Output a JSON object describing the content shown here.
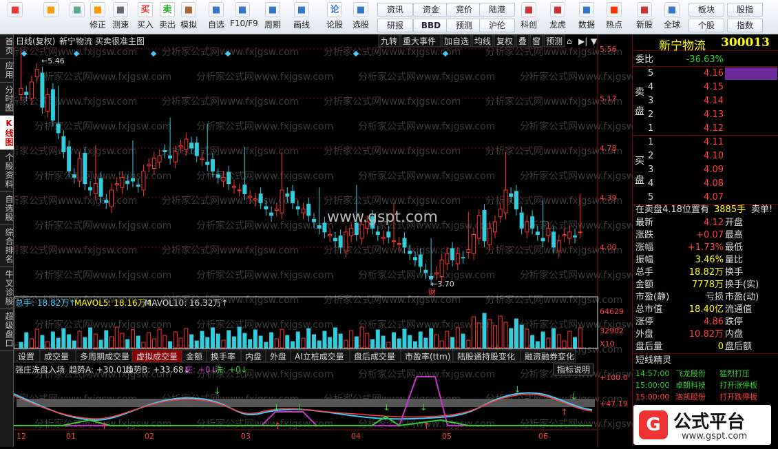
{
  "toolbar": {
    "buttons": [
      {
        "label": "",
        "icon": "grid-icon"
      },
      {
        "label": "",
        "icon": "back-arrow-icon"
      },
      {
        "label": "",
        "icon": "up-down-icon"
      },
      {
        "label": "修正",
        "icon": "fix-icon"
      },
      {
        "label": "测速",
        "icon": "clock-icon"
      },
      {
        "label": "买入",
        "icon": "buy-icon",
        "glyph": "买"
      },
      {
        "label": "卖出",
        "icon": "sell-icon",
        "glyph": "卖"
      },
      {
        "label": "模拟",
        "icon": "hammer-icon"
      },
      {
        "label": "自选",
        "icon": "star-icon"
      },
      {
        "label": "F10/F9",
        "icon": "f10-icon"
      },
      {
        "label": "周期",
        "icon": "cycle-icon"
      },
      {
        "label": "画线",
        "icon": "pen-icon"
      },
      {
        "label": "论股",
        "icon": "discuss-icon",
        "glyph": "论"
      },
      {
        "label": "选股",
        "icon": "select-icon"
      },
      {
        "label": "科创",
        "icon": "kechuang-icon"
      },
      {
        "label": "龙虎",
        "icon": "dragon-icon"
      },
      {
        "label": "数据",
        "icon": "pe-icon"
      },
      {
        "label": "热点",
        "icon": "fire-icon"
      },
      {
        "label": "新股",
        "icon": "newstock-icon"
      },
      {
        "label": "全球",
        "icon": "globe-icon"
      }
    ],
    "small_buttons": [
      "资讯",
      "资金",
      "竞价",
      "陆港",
      "研报",
      "BBD",
      "预测",
      "沪伦",
      "板块",
      "股指",
      "个股",
      "指数"
    ]
  },
  "left_tabs": [
    "首页",
    "应用",
    "分时图",
    "K线图",
    "个股资料",
    "自选股",
    "综合排名",
    "牛叉诊股",
    "超级盘口"
  ],
  "chart": {
    "title": "日线(复权)",
    "stock_name": "新宁物流",
    "indicator_name": "买卖很准主图",
    "top_buttons": [
      "九转",
      "重大事件",
      "加自选",
      "均线",
      "复权",
      "叠",
      "窗",
      "预测"
    ],
    "price_labels": [
      "5.56",
      "5.17",
      "4.78",
      "4.39",
      "4.00"
    ],
    "high_mark": "5.46",
    "low_mark": "3.70",
    "low_tag": "财",
    "watermark": "www.gspt.com",
    "watermark_bg": "分析家公式网www.fxjgsw.com",
    "volume_title": "总手: 18.82万↑",
    "mavol5": "MAVOL5: 18.16万↑",
    "mavol10": "MAVOL10: 16.32万↑",
    "volume_labels": [
      "64629",
      "32902",
      "X10"
    ],
    "indicator_tabs": [
      "设置",
      "成交量",
      "多周期成交量",
      "虚拟成交量",
      "金额",
      "换手率",
      "内盘",
      "外盘",
      "AI立桩成交量",
      "盘后成交量",
      "市盈率(ttm)",
      "陆股通持股变化",
      "融资融券变化"
    ],
    "sub_title": "强庄洗盘入场",
    "sub_values": [
      "趋势A: +30.01↓",
      "趋势B: +33.68↓",
      "庄: +0↓",
      "洗: +0↓"
    ],
    "sub_button": "指标说明",
    "sub_labels": [
      "+100.0",
      "+47.19"
    ],
    "months": [
      "12",
      "01",
      "02",
      "03",
      "04",
      "05",
      "06"
    ],
    "brand_text": "公式平台",
    "brand_url": "www.gspt.com"
  },
  "quote": {
    "name": "新宁物流",
    "code": "300013",
    "weibi_label": "委比",
    "weibi": "-36.63%",
    "sell_label": "卖盘",
    "buy_label": "买盘",
    "sells": [
      {
        "lvl": "5",
        "price": "4.16"
      },
      {
        "lvl": "4",
        "price": "4.15"
      },
      {
        "lvl": "3",
        "price": "4.14"
      },
      {
        "lvl": "2",
        "price": "4.13"
      },
      {
        "lvl": "1",
        "price": "4.12"
      }
    ],
    "buys": [
      {
        "lvl": "1",
        "price": "4.11"
      },
      {
        "lvl": "2",
        "price": "4.10"
      },
      {
        "lvl": "3",
        "price": "4.09"
      },
      {
        "lvl": "4",
        "price": "4.08"
      },
      {
        "lvl": "5",
        "price": "4.07"
      }
    ],
    "notice": "在卖盘4.18位置有",
    "notice_vol": "3885手",
    "notice_tag": "卖单!",
    "stats": [
      {
        "l": "最新",
        "v": "4.12",
        "r": "开盘",
        "c": "red"
      },
      {
        "l": "涨跌",
        "v": "+0.07",
        "r": "最高",
        "c": "red"
      },
      {
        "l": "涨幅",
        "v": "+1.73%",
        "r": "最低",
        "c": "red"
      },
      {
        "l": "振幅",
        "v": "3.46%",
        "r": "量比",
        "c": "yellow"
      },
      {
        "l": "总手",
        "v": "18.82万",
        "r": "换手",
        "c": "yellow"
      },
      {
        "l": "金额",
        "v": "7778万",
        "r": "换手(实)",
        "c": "yellow"
      },
      {
        "l": "市盈(静)",
        "v": "亏损",
        "r": "市盈(动)",
        "c": "white"
      },
      {
        "l": "总市值",
        "v": "18.40亿",
        "r": "流通值",
        "c": "yellow"
      },
      {
        "l": "涨停",
        "v": "4.86",
        "r": "跌停",
        "c": "red"
      },
      {
        "l": "外盘",
        "v": "10.82万",
        "r": "内盘",
        "c": "red"
      },
      {
        "l": "盘后量",
        "v": "0",
        "r": "盘后额",
        "c": "yellow"
      }
    ],
    "elves_title": "短线精灵",
    "elves": [
      {
        "t": "14:57:00",
        "n": "飞龙股份",
        "e": "猛烈打压",
        "c": "green"
      },
      {
        "t": "15:00:00",
        "n": "卓朗科技",
        "e": "打开涨停板",
        "c": "green"
      },
      {
        "t": "15:00:00",
        "n": "洛凯股份",
        "e": "打开跌停板",
        "c": "red"
      }
    ]
  }
}
